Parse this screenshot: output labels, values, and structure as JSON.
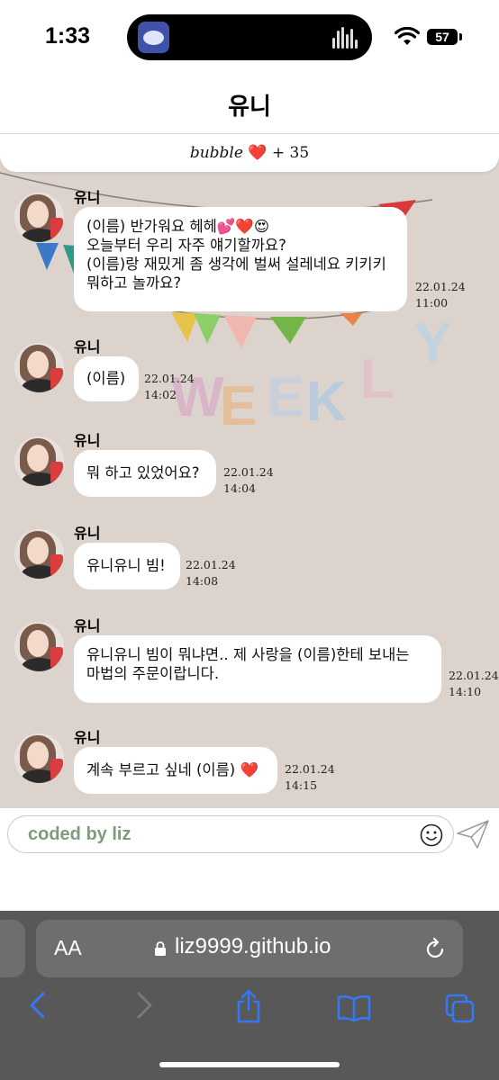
{
  "status_bar": {
    "time": "1:33",
    "battery": "57"
  },
  "chat": {
    "title": "유니",
    "bubble_counter": {
      "word": "bubble",
      "heart": "❤️",
      "count": "+ 35"
    }
  },
  "messages": [
    {
      "sender": "유니",
      "text": "(이름) 반가워요 헤헤💕❤️😍\n오늘부터 우리 자주 얘기할까요?\n(이름)랑 재밌게 좀 생각에 벌써 설레네요 키키키\n뭐하고 놀까요?",
      "date": "22.01.24",
      "time": "11:00"
    },
    {
      "sender": "유니",
      "text": "(이름)",
      "date": "22.01.24",
      "time": "14:02"
    },
    {
      "sender": "유니",
      "text": "뭐 하고 있었어요?",
      "date": "22.01.24",
      "time": "14:04"
    },
    {
      "sender": "유니",
      "text": "유니유니 빔!",
      "date": "22.01.24",
      "time": "14:08"
    },
    {
      "sender": "유니",
      "text": "유니유니 빔이 뭐냐면.. 제 사랑을 (이름)한테 보내는\n마법의 주문이랍니다.",
      "date": "22.01.24",
      "time": "14:10"
    },
    {
      "sender": "유니",
      "text": "계속 부르고 싶네 (이름) ❤️",
      "date": "22.01.24",
      "time": "14:15"
    }
  ],
  "input": {
    "value": "coded by liz"
  },
  "browser": {
    "aa_label": "AA",
    "url": "liz9999.github.io"
  },
  "colors": {
    "accent": "#3478f6",
    "chat_bg": "#dcd3cc",
    "input_text": "#7f9a7f"
  },
  "icons": [
    "app-icon",
    "audio-wave-icon",
    "wifi-icon",
    "battery-icon",
    "smile-icon",
    "send-icon",
    "lock-icon",
    "reload-icon",
    "back-icon",
    "forward-icon",
    "share-icon",
    "bookmarks-icon",
    "tabs-icon"
  ]
}
